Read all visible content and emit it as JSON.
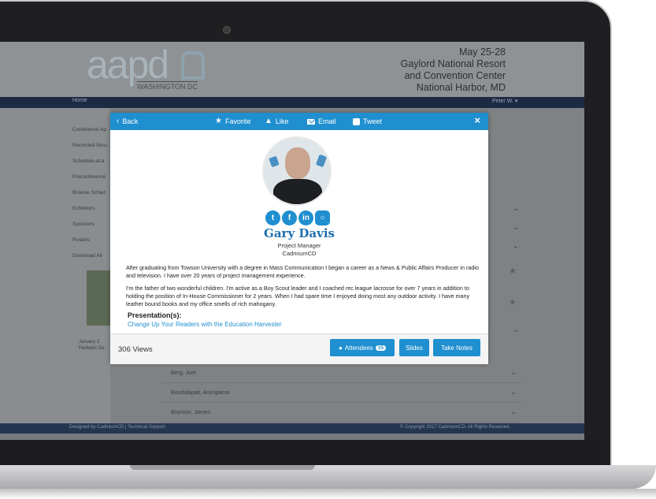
{
  "header": {
    "logo_text": "aapd",
    "logo_sub": "WASHINGTON DC",
    "event_lines": [
      "May 25-28",
      "Gaylord National Resort",
      "and Convention Center",
      "National Harbor, MD"
    ]
  },
  "nav": {
    "home": "Home",
    "user": "Peter W. ▾"
  },
  "sidebar": {
    "items": [
      "Conference Ap",
      "Recorded Sess",
      "Schedule-at-a",
      "Preconference",
      "Browse Sched",
      "Exhibitors",
      "Sponsors",
      "Posters",
      "Download All"
    ],
    "caption": [
      "January 2",
      "Pediatric De"
    ]
  },
  "list": {
    "rows": [
      "Berg, Joel",
      "Bondalapati, Anirupama",
      "Boynton, James"
    ]
  },
  "footer": {
    "left": "Designed by CadmiumCD | Technical Support",
    "right": "© Copyright 2017 CadmiumCD. All Rights Reserved."
  },
  "modal": {
    "back": "Back",
    "favorite": "Favorite",
    "like": "Like",
    "email": "Email",
    "tweet": "Tweet",
    "close": "×",
    "person": {
      "name": "Gary Davis",
      "title": "Project Manager",
      "org": "CadmiumCD"
    },
    "social_icons": [
      "twitter-icon",
      "facebook-icon",
      "linkedin-icon",
      "instagram-icon"
    ],
    "bio": [
      "After graduating from Towson University with a degree in Mass Communication I began a career as a News & Public Affairs Producer in radio and television. I have over 20 years of project management experience.",
      "I'm the father of two wonderful children. I'm active as a Boy Scout leader and I coached rec league lacrosse for over 7 years in addition to holding the position of In-House Commissioner for 2 years. When I had spare time I enjoyed doing most any outdoor activity. I have many leather bound books and my office smells of rich mahogany."
    ],
    "presentations_label": "Presentation(s):",
    "presentation_link": "Change Up Your Readers with the Education Harvester",
    "views": "306 Views",
    "buttons": {
      "attendees": "Attendees",
      "attendees_count": "15",
      "slides": "Slides",
      "notes": "Take Notes"
    }
  },
  "colors": {
    "accent": "#1f8fd0",
    "name": "#1f6fae"
  }
}
